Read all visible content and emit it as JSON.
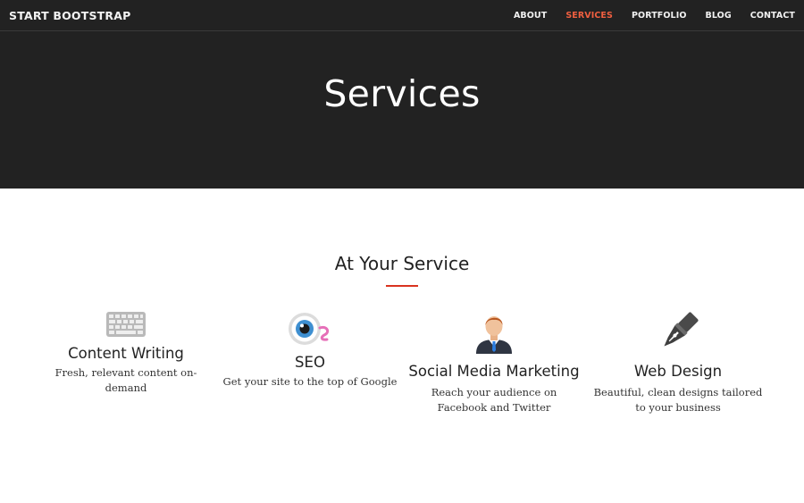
{
  "navbar": {
    "brand": "START BOOTSTRAP",
    "items": [
      {
        "label": "ABOUT",
        "active": false
      },
      {
        "label": "SERVICES",
        "active": true
      },
      {
        "label": "PORTFOLIO",
        "active": false
      },
      {
        "label": "BLOG",
        "active": false
      },
      {
        "label": "CONTACT",
        "active": false
      }
    ],
    "active_color": "#f05f40"
  },
  "hero": {
    "title": "Services",
    "background": "#222222"
  },
  "section": {
    "heading": "At Your Service",
    "divider_color": "#d9331f",
    "services": [
      {
        "icon": "keyboard-icon",
        "title": "Content Writing",
        "description": "Fresh, relevant content on-demand"
      },
      {
        "icon": "eye-icon",
        "title": "SEO",
        "description": "Get your site to the top of Google"
      },
      {
        "icon": "businessman-icon",
        "title": "Social Media Marketing",
        "description": "Reach your audience on Facebook and Twitter"
      },
      {
        "icon": "fountain-pen-icon",
        "title": "Web Design",
        "description": "Beautiful, clean designs tailored to your business"
      }
    ]
  }
}
